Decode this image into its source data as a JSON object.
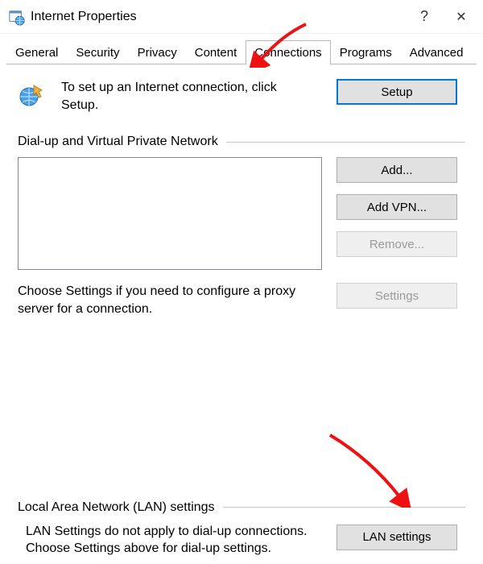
{
  "window": {
    "title": "Internet Properties"
  },
  "tabs": {
    "general": "General",
    "security": "Security",
    "privacy": "Privacy",
    "content": "Content",
    "connections": "Connections",
    "programs": "Programs",
    "advanced": "Advanced"
  },
  "conn": {
    "setup_text": "To set up an Internet connection, click Setup.",
    "setup_btn": "Setup",
    "dialup_header": "Dial-up and Virtual Private Network",
    "add_btn": "Add...",
    "addvpn_btn": "Add VPN...",
    "remove_btn": "Remove...",
    "proxy_text": "Choose Settings if you need to configure a proxy server for a connection.",
    "settings_btn": "Settings",
    "lan_header": "Local Area Network (LAN) settings",
    "lan_text": "LAN Settings do not apply to dial-up connections. Choose Settings above for dial-up settings.",
    "lan_btn": "LAN settings"
  }
}
